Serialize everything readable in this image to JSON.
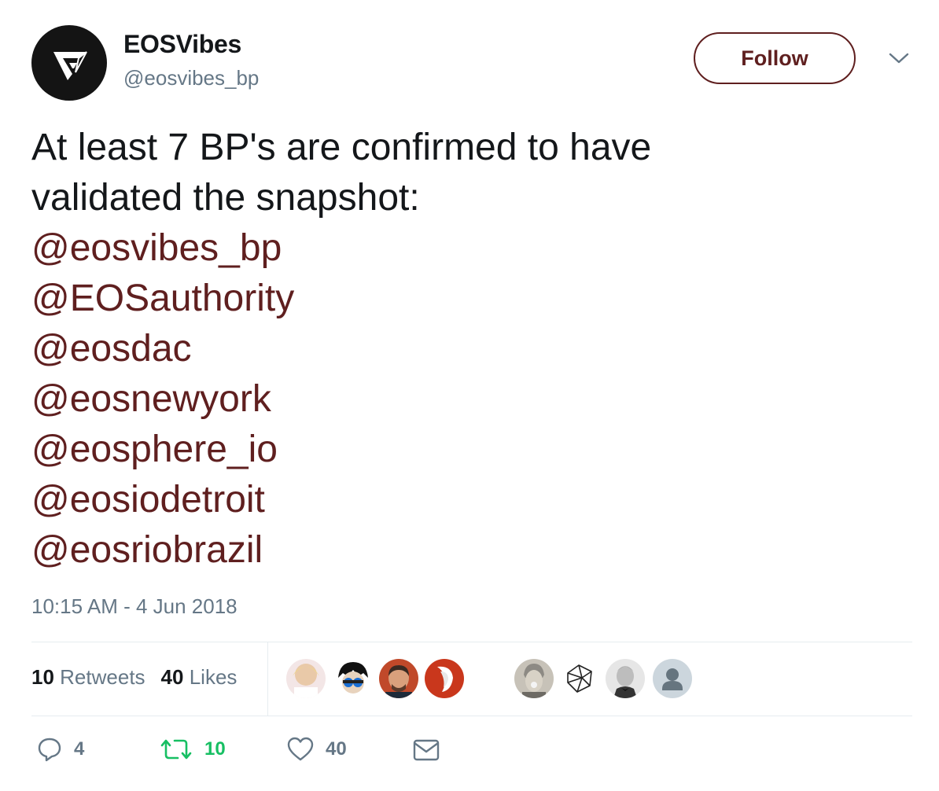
{
  "header": {
    "display_name": "EOSVibes",
    "handle": "@eosvibes_bp",
    "follow_label": "Follow",
    "avatar_icon": "eosvibes-logo-icon",
    "more_icon": "chevron-down-icon"
  },
  "tweet": {
    "text_lines": [
      "At least 7 BP's are confirmed to have",
      "validated the snapshot:"
    ],
    "mentions": [
      "@eosvibes_bp",
      "@EOSauthority",
      "@eosdac",
      "@eosnewyork",
      "@eosphere_io",
      "@eosiodetroit",
      "@eosriobrazil"
    ],
    "timestamp": "10:15 AM - 4 Jun 2018"
  },
  "stats": {
    "retweets_count": "10",
    "retweets_label": "Retweets",
    "likes_count": "40",
    "likes_label": "Likes"
  },
  "likers": [
    {
      "icon": "user-avatar-icon"
    },
    {
      "icon": "user-avatar-icon"
    },
    {
      "icon": "user-avatar-icon"
    },
    {
      "icon": "user-avatar-icon"
    },
    {
      "icon": "user-avatar-icon"
    },
    {
      "icon": "geometric-logo-icon"
    },
    {
      "icon": "user-avatar-icon"
    },
    {
      "icon": "default-avatar-icon"
    }
  ],
  "actions": {
    "reply_count": "4",
    "retweet_count": "10",
    "like_count": "40"
  },
  "colors": {
    "accent": "#5f1f1f",
    "text": "#14171a",
    "muted": "#657786",
    "retweet_green": "#17bf63",
    "divider": "#e6ecf0"
  }
}
